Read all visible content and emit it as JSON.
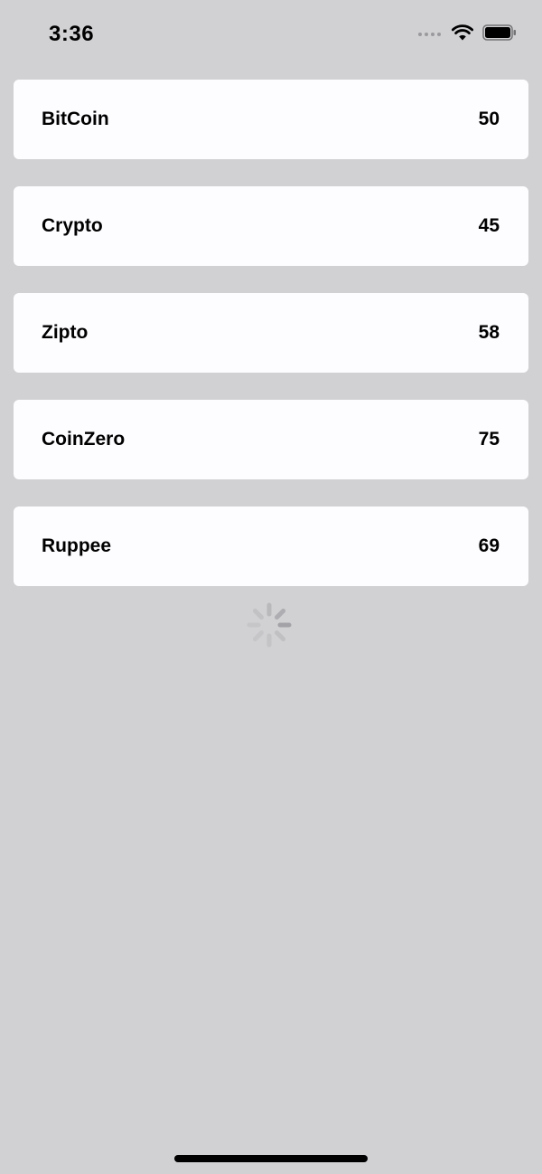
{
  "status_bar": {
    "time": "3:36",
    "icons": [
      "signal-dots-icon",
      "wifi-icon",
      "battery-icon"
    ]
  },
  "coins": [
    {
      "name": "BitCoin",
      "value": "50"
    },
    {
      "name": "Crypto",
      "value": "45"
    },
    {
      "name": "Zipto",
      "value": "58"
    },
    {
      "name": "CoinZero",
      "value": "75"
    },
    {
      "name": "Ruppee",
      "value": "69"
    }
  ],
  "loading_indicator": "spinner-icon",
  "colors": {
    "background": "#d1d0d3",
    "card": "#fdfcff",
    "text": "#000000"
  }
}
